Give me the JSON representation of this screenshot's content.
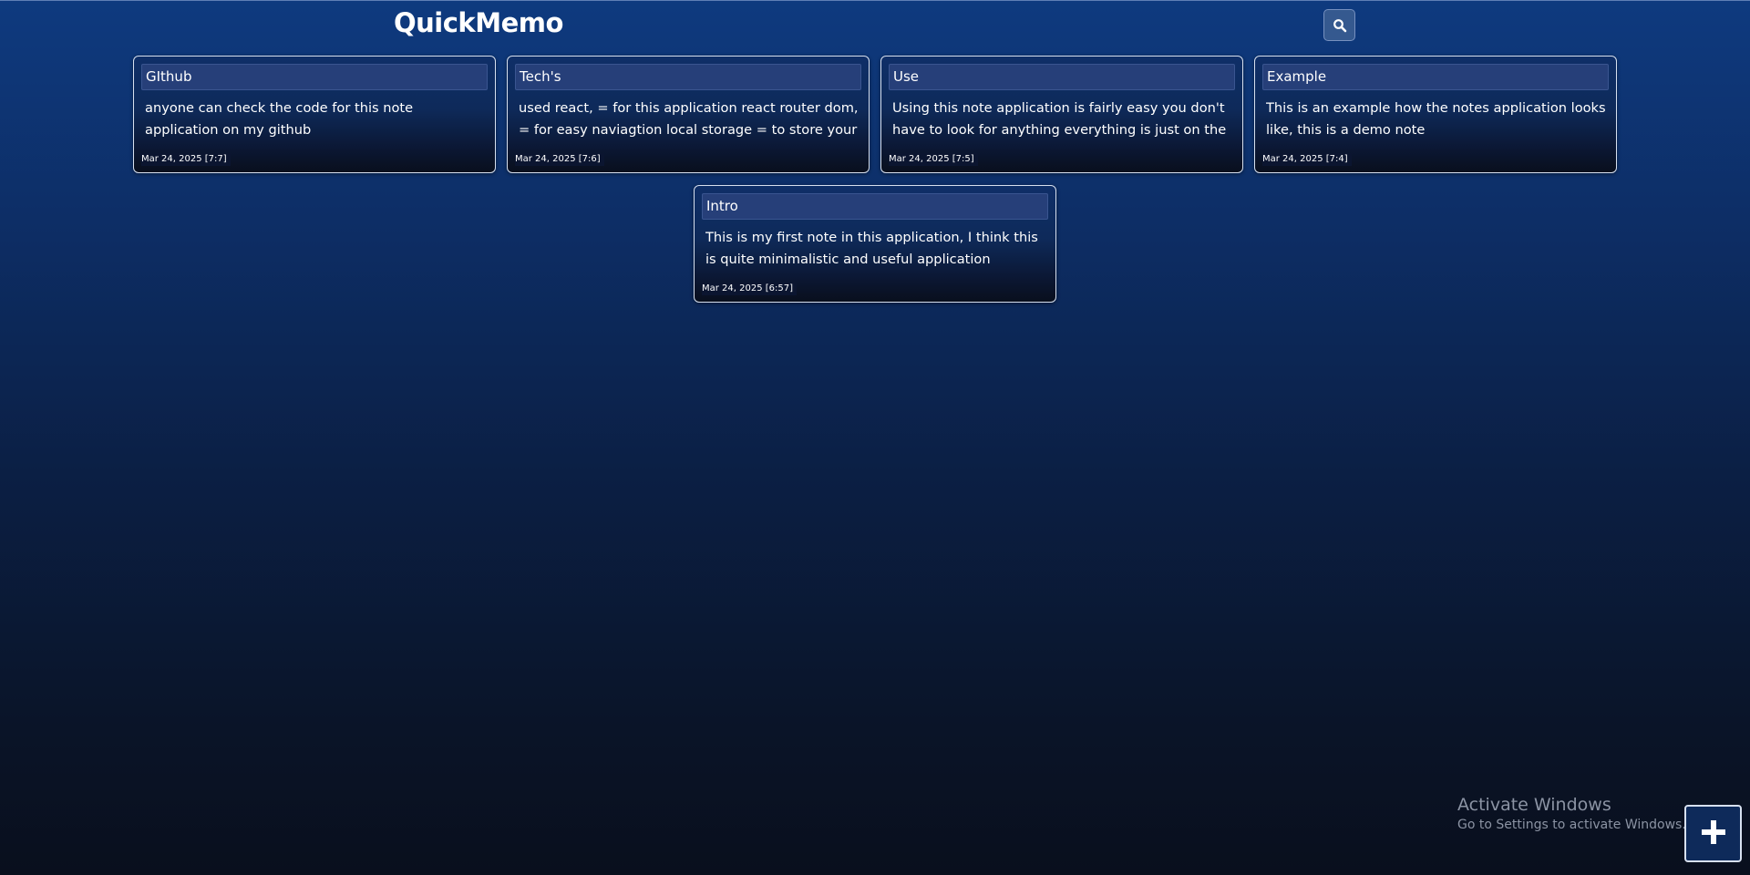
{
  "app": {
    "title": "QuickMemo"
  },
  "toolbar": {
    "search_icon": "search-icon",
    "add_icon": "plus-icon"
  },
  "notes": [
    {
      "title": "GIthub",
      "body": "anyone can check the code for this note application on my github",
      "date": "Mar 24, 2025 [7:7]"
    },
    {
      "title": "Tech's",
      "body": "used react, = for this application react router dom, = for easy naviagtion local storage = to store your data locally on your local storage and can access later",
      "date": "Mar 24, 2025 [7:6]"
    },
    {
      "title": "Use",
      "body": "Using this note application is fairly easy you don't have to look for anything everything is just on the right of your screen",
      "date": "Mar 24, 2025 [7:5]"
    },
    {
      "title": "Example",
      "body": "This is an example how the notes application looks like, this is a demo note",
      "date": "Mar 24, 2025 [7:4]"
    },
    {
      "title": "Intro",
      "body": "This is my first note in this application, I think this is quite minimalistic and useful application",
      "date": "Mar 24, 2025 [6:57]"
    }
  ],
  "watermark": {
    "title": "Activate Windows",
    "subtitle": "Go to Settings to activate Windows."
  },
  "colors": {
    "accent": "#0e3a7f",
    "card_border": "#d7e0ef",
    "title_box": "#263f79"
  }
}
